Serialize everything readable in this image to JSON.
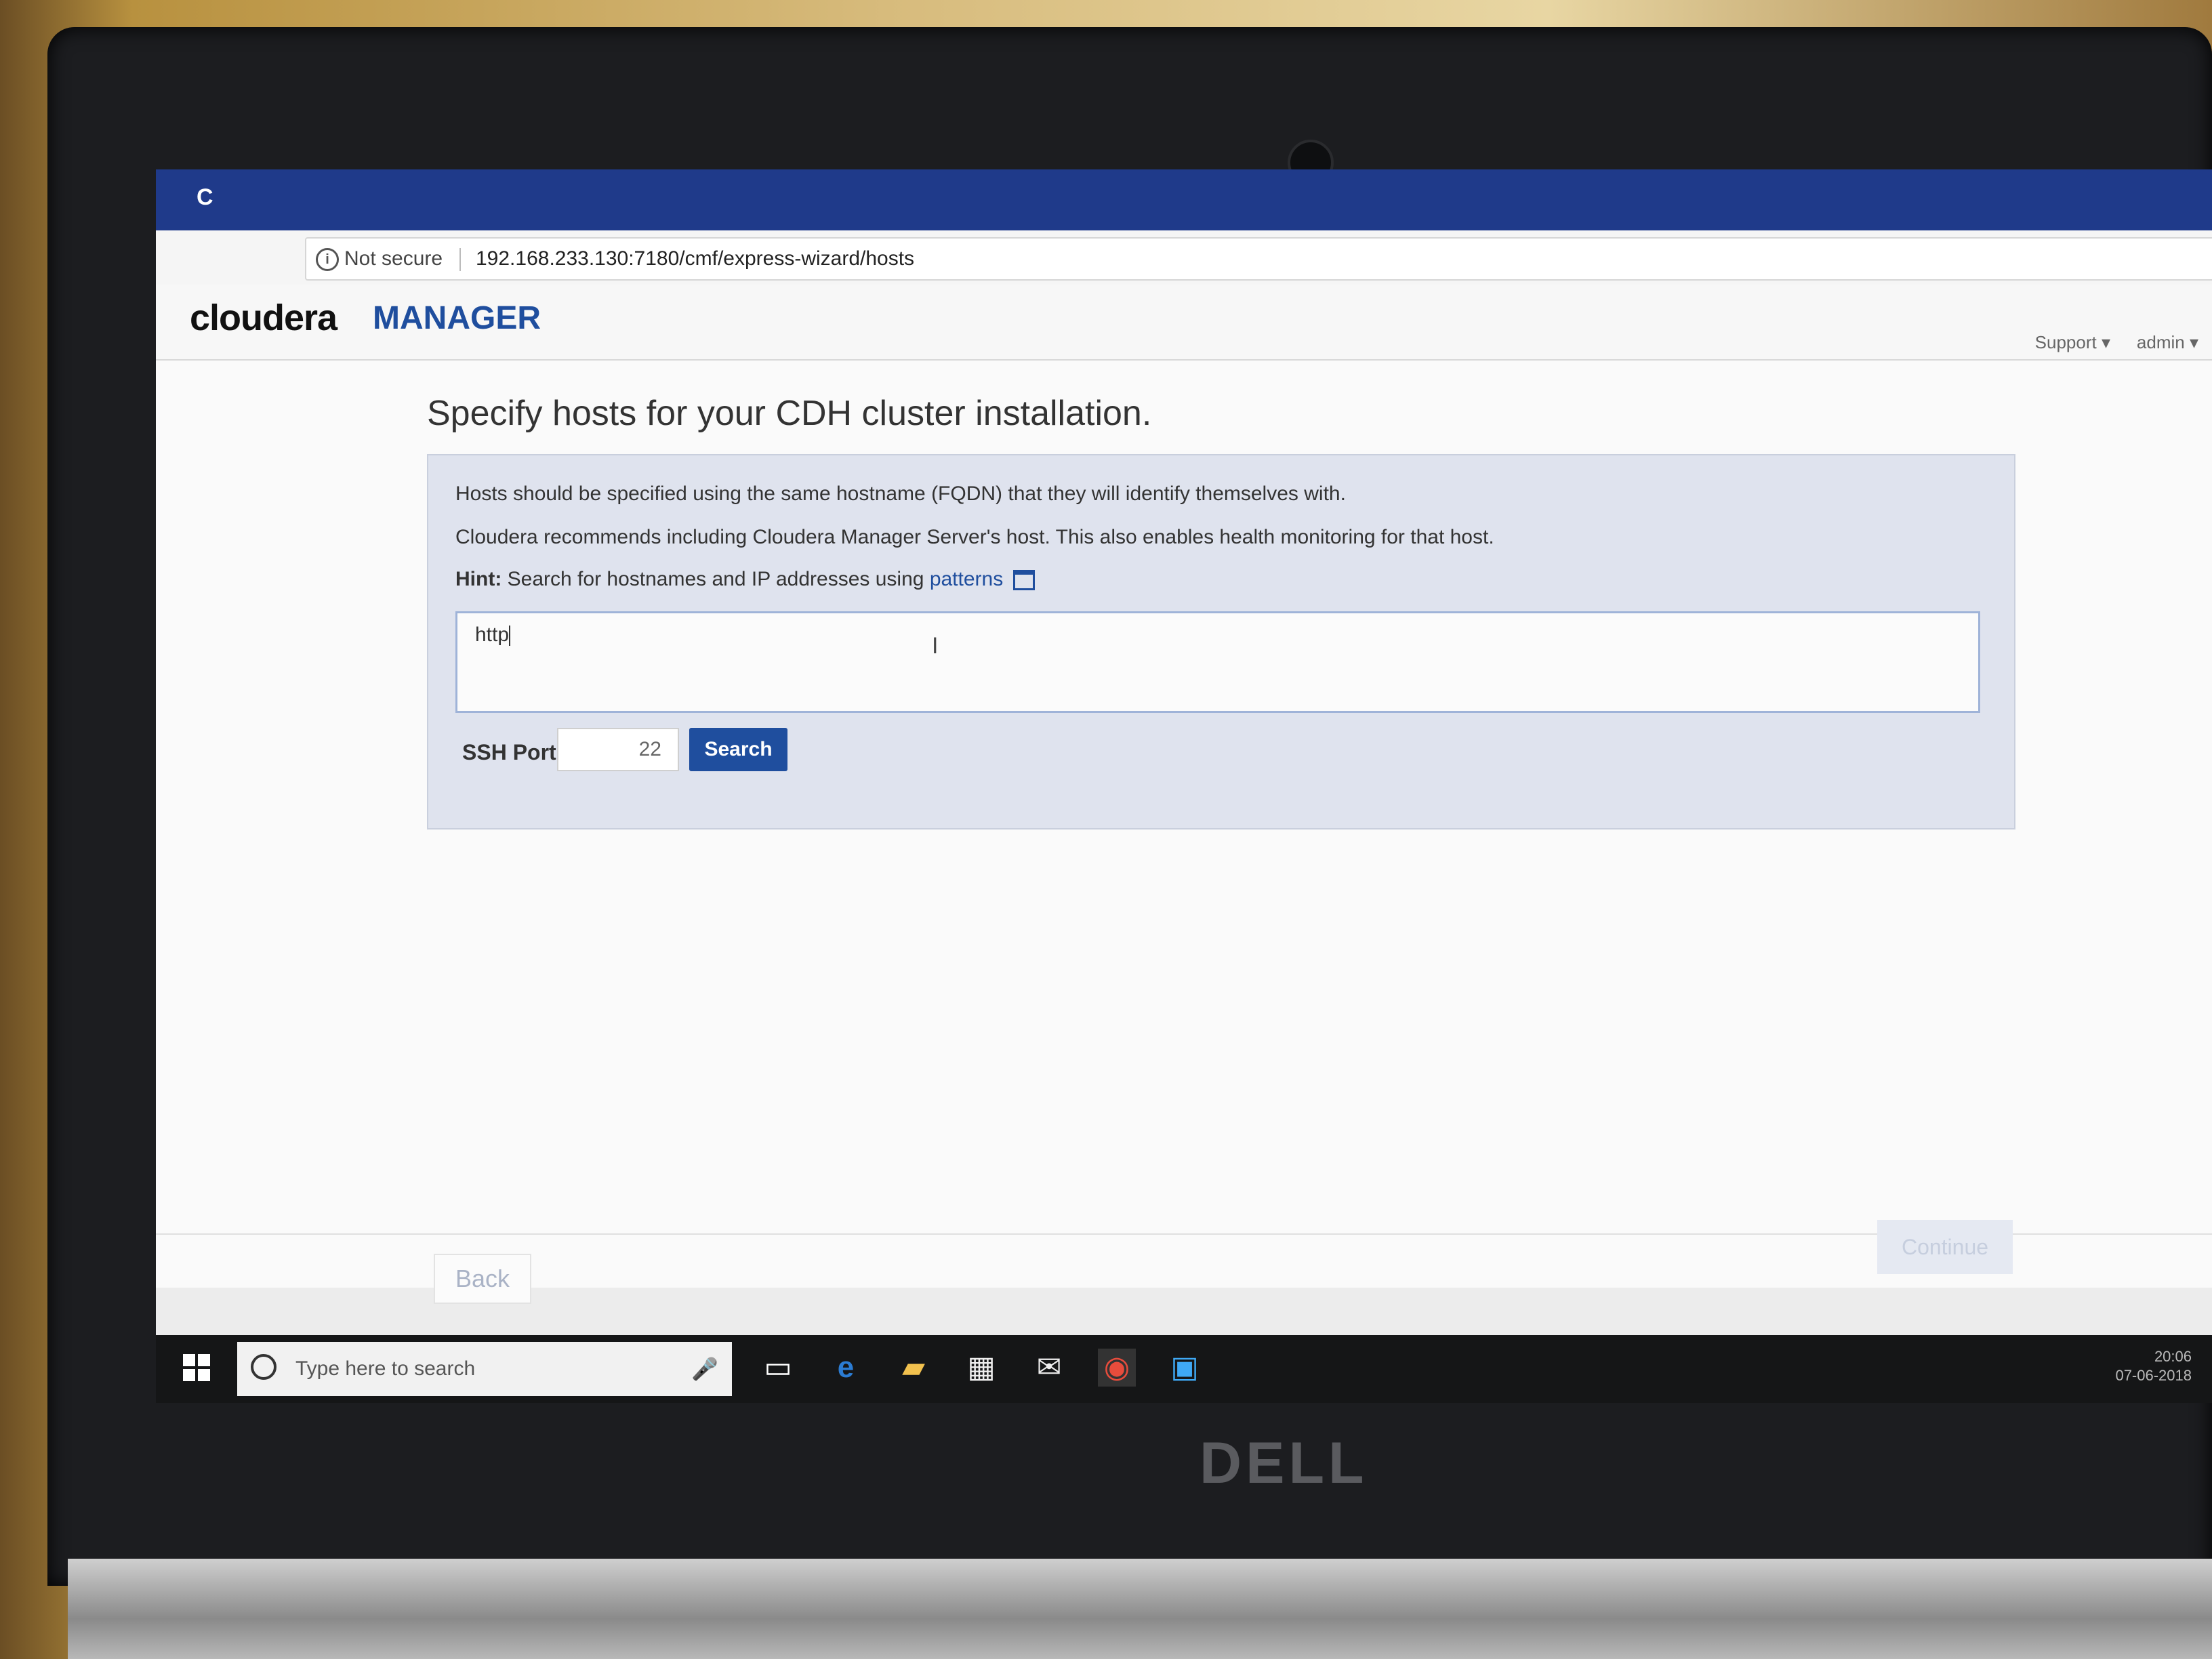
{
  "browser": {
    "tab_icon": "C",
    "security_label": "Not secure",
    "url": "192.168.233.130:7180/cmf/express-wizard/hosts"
  },
  "header": {
    "logo_brand": "cloudera",
    "logo_product": "MANAGER",
    "support_menu": "Support ▾",
    "admin_menu": "admin ▾"
  },
  "main": {
    "title": "Specify hosts for your CDH cluster installation.",
    "info_line_1": "Hosts should be specified using the same hostname (FQDN) that they will identify themselves with.",
    "info_line_2": "Cloudera recommends including Cloudera Manager Server's host. This also enables health monitoring for that host.",
    "hint_label": "Hint:",
    "hint_text": "Search for hostnames and IP addresses using",
    "hint_link": "patterns",
    "hosts_value": "http",
    "ssh_port_label": "SSH Port:",
    "ssh_port_value": "22",
    "search_button": "Search"
  },
  "footer": {
    "back_button": "Back",
    "continue_button": "Continue"
  },
  "taskbar": {
    "search_placeholder": "Type here to search",
    "clock_time": "20:06",
    "clock_date": "07-06-2018"
  },
  "device": {
    "brand": "DELL"
  }
}
